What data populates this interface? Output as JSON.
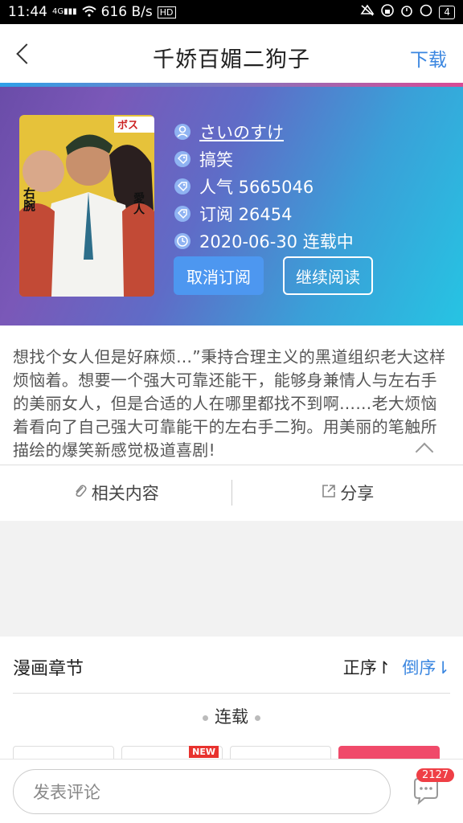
{
  "status_bar": {
    "time": "11:44",
    "network": "4G",
    "speed": "616 B/s",
    "hd": "HD",
    "battery": "4"
  },
  "nav": {
    "title": "千娇百媚二狗子",
    "download_label": "下载"
  },
  "comic": {
    "author": "さいのすけ",
    "genre": "搞笑",
    "popularity": "人气 5665046",
    "subscriptions": "订阅 26454",
    "update": "2020-06-30 连载中",
    "unsubscribe_label": "取消订阅",
    "continue_label": "继续阅读",
    "cover_text": {
      "top_right": "ボス",
      "left_badge": "右腕",
      "right_badge": "愛人"
    },
    "description": "想找个女人但是好麻烦…”秉持合理主义的黑道组织老大这样烦恼着。想要一个强大可靠还能干，能够身兼情人与左右手的美丽女人，但是合适的人在哪里都找不到啊……老大烦恼着看向了自己强大可靠能干的左右手二狗。用美丽的笔触所描绘的爆笑新感觉极道喜剧!"
  },
  "actions": {
    "related_label": "相关内容",
    "share_label": "分享"
  },
  "chapters": {
    "title": "漫画章节",
    "sort_asc": "正序↾",
    "sort_desc": "倒序⇂",
    "section": "连载",
    "new_badge": "NEW"
  },
  "bottom": {
    "comment_placeholder": "发表评论",
    "comment_count": "2127"
  },
  "colors": {
    "accent": "#3a86e0",
    "unsubscribe_bg": "#4d97f0",
    "badge_red": "#ef3f46",
    "chapter_red": "#f04a6a"
  }
}
